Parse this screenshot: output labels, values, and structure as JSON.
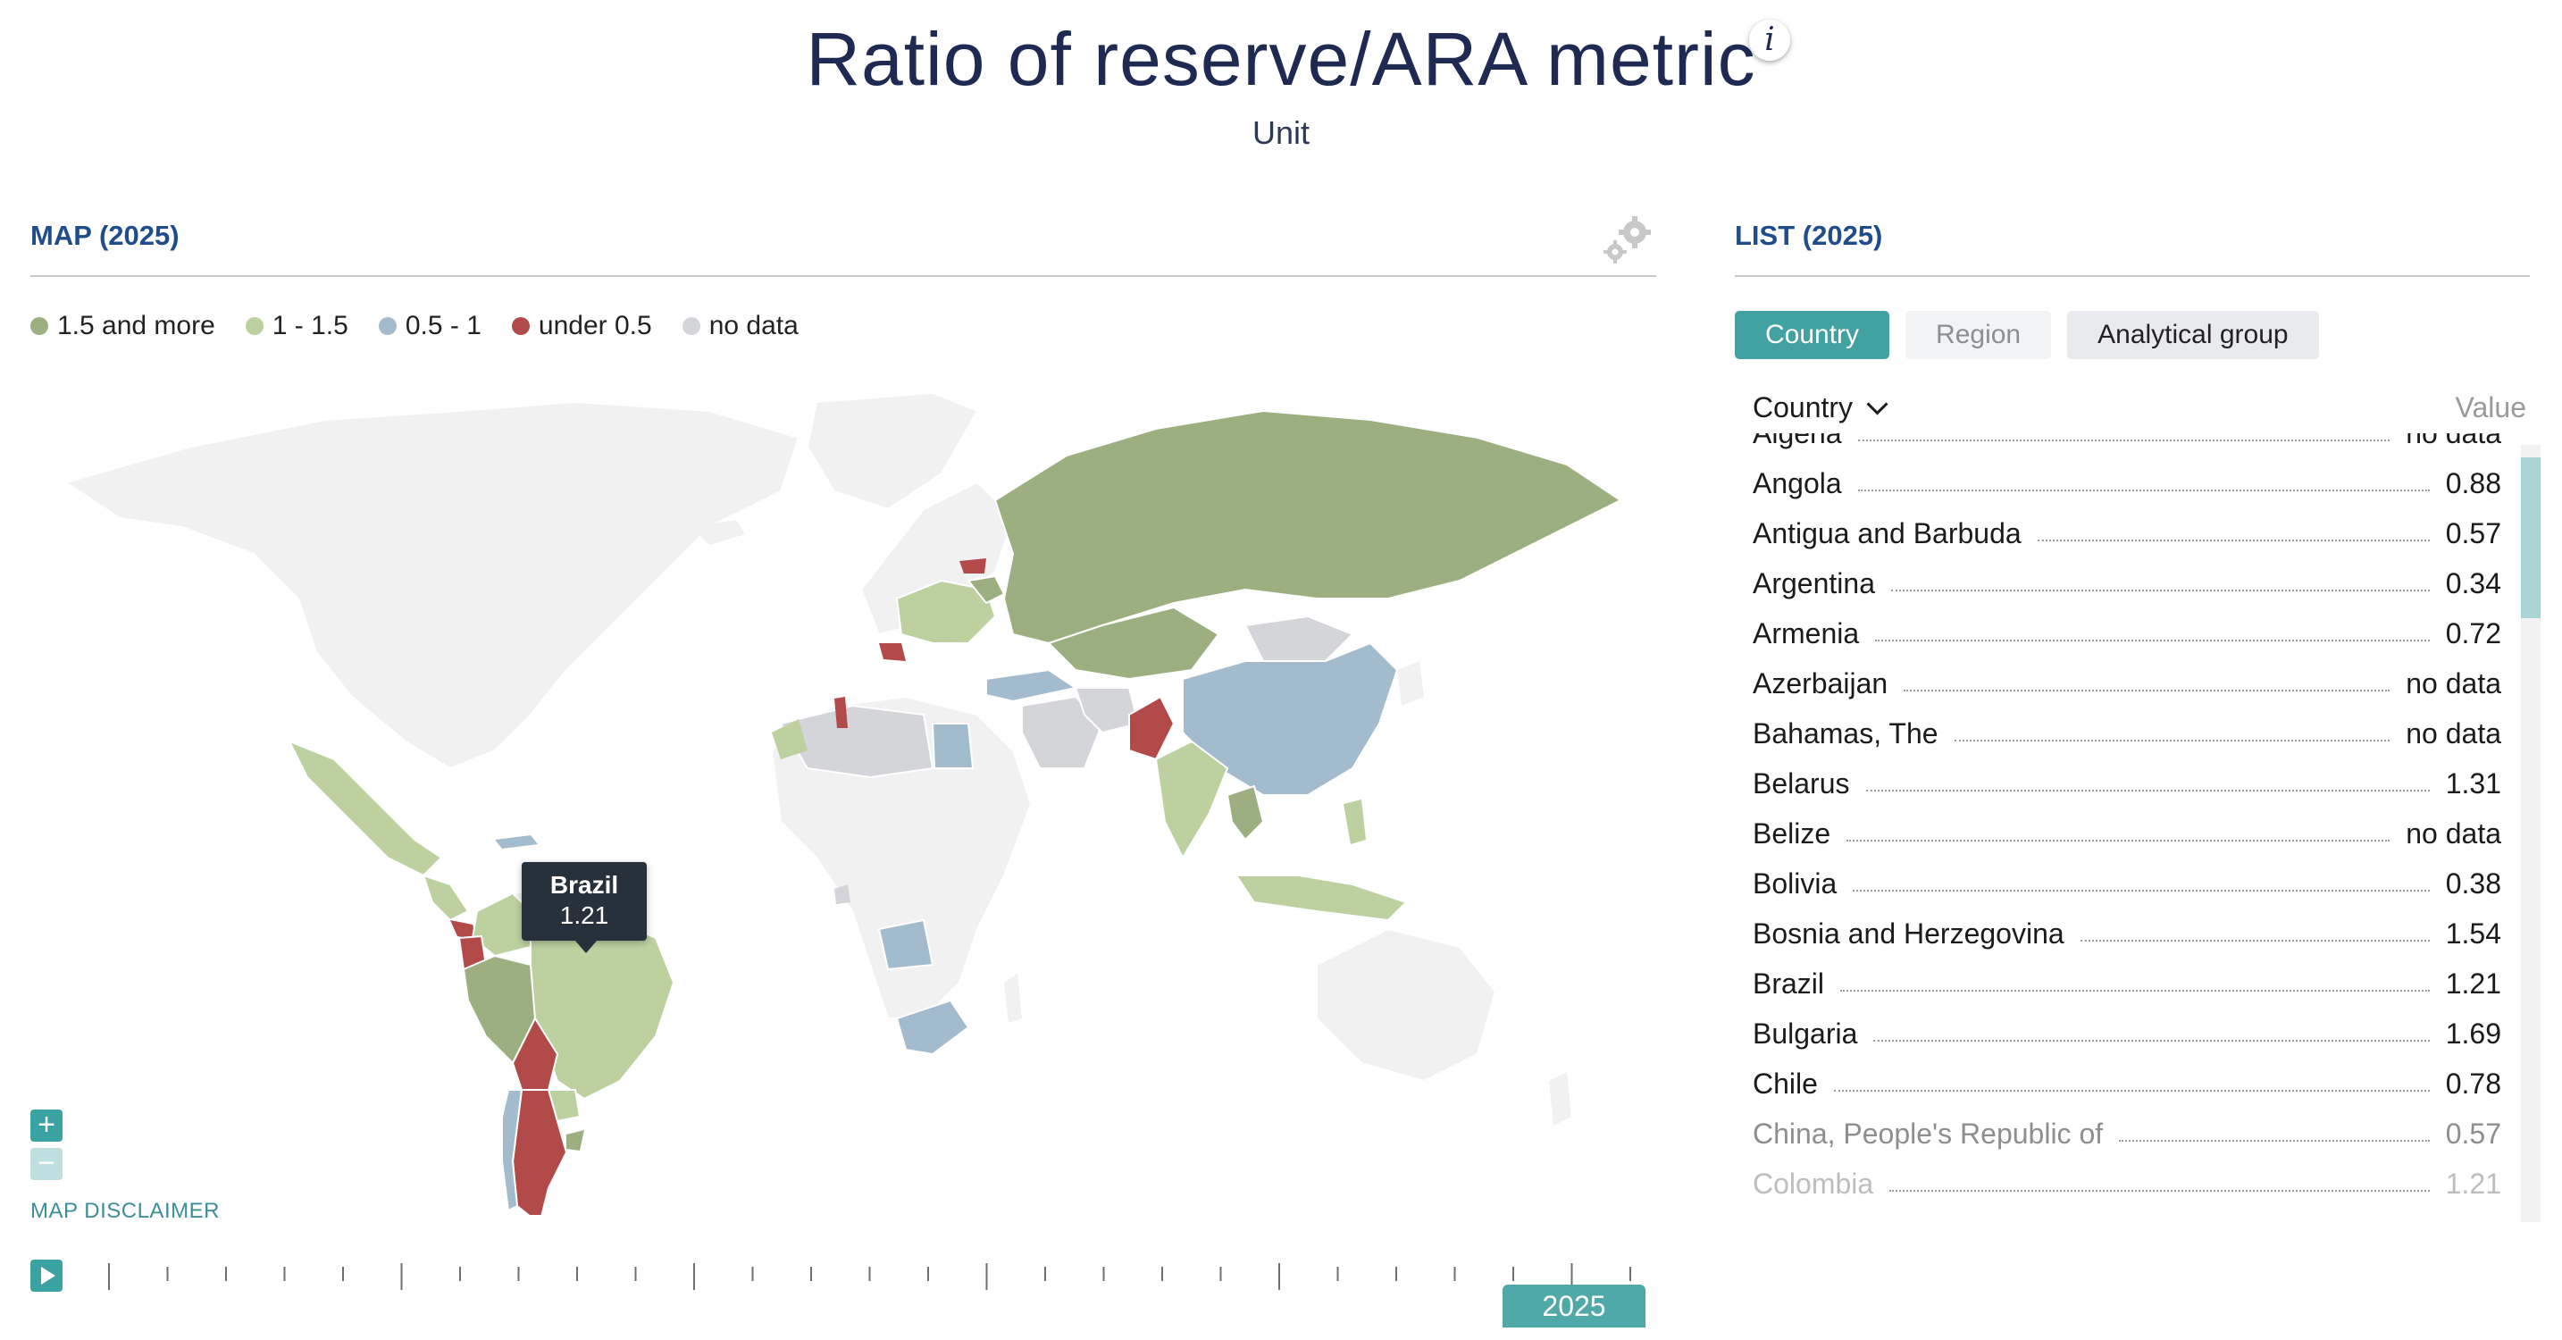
{
  "header": {
    "title": "Ratio of reserve/ARA metric",
    "subtitle": "Unit",
    "info_icon": "info-icon"
  },
  "map": {
    "title": "MAP (2025)",
    "settings_icon": "gear-icon",
    "legend": [
      {
        "label": "1.5 and more",
        "color": "#9caf80"
      },
      {
        "label": "1 - 1.5",
        "color": "#bcd0a0"
      },
      {
        "label": "0.5 - 1",
        "color": "#a3bccd"
      },
      {
        "label": "under 0.5",
        "color": "#b24a4a"
      },
      {
        "label": "no data",
        "color": "#d4d5d8"
      }
    ],
    "tooltip": {
      "name": "Brazil",
      "value": "1.21"
    },
    "zoom_in_icon": "plus-icon",
    "zoom_out_icon": "minus-icon",
    "disclaimer": "MAP DISCLAIMER",
    "timeline": {
      "play_icon": "play-icon",
      "year": "2025",
      "progress": 1.0
    }
  },
  "list": {
    "title": "LIST (2025)",
    "tabs": [
      {
        "label": "Country",
        "active": true
      },
      {
        "label": "Region",
        "active": false
      },
      {
        "label": "Analytical group",
        "active": false
      }
    ],
    "column_country": "Country",
    "column_value": "Value",
    "sort_icon": "chevron-down-icon",
    "rows": [
      {
        "name": "Algeria",
        "value": "no data"
      },
      {
        "name": "Angola",
        "value": "0.88"
      },
      {
        "name": "Antigua and Barbuda",
        "value": "0.57"
      },
      {
        "name": "Argentina",
        "value": "0.34"
      },
      {
        "name": "Armenia",
        "value": "0.72"
      },
      {
        "name": "Azerbaijan",
        "value": "no data"
      },
      {
        "name": "Bahamas, The",
        "value": "no data"
      },
      {
        "name": "Belarus",
        "value": "1.31"
      },
      {
        "name": "Belize",
        "value": "no data"
      },
      {
        "name": "Bolivia",
        "value": "0.38"
      },
      {
        "name": "Bosnia and Herzegovina",
        "value": "1.54"
      },
      {
        "name": "Brazil",
        "value": "1.21"
      },
      {
        "name": "Bulgaria",
        "value": "1.69"
      },
      {
        "name": "Chile",
        "value": "0.78"
      },
      {
        "name": "China, People's Republic of",
        "value": "0.57"
      },
      {
        "name": "Colombia",
        "value": "1.21"
      }
    ]
  },
  "colors": {
    "accent": "#42a2a2",
    "title": "#1e2a52",
    "panel_title": "#1f4d8c",
    "land_nodata": "#f1f1f1"
  }
}
